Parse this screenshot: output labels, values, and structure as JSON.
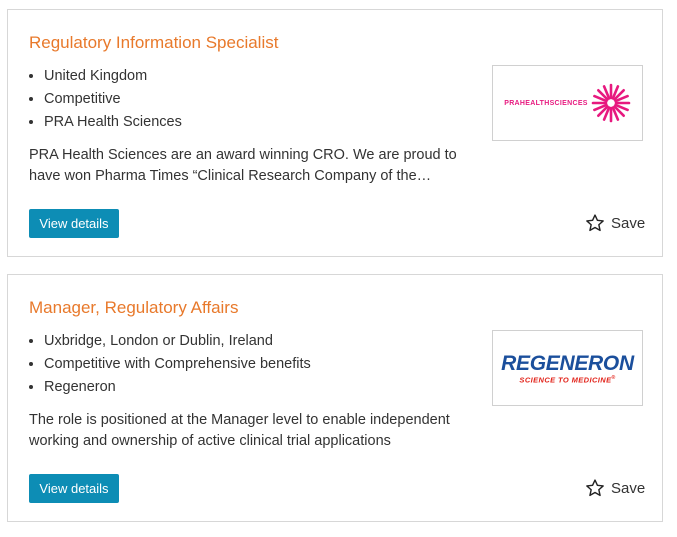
{
  "jobs": [
    {
      "title": "Regulatory Information Specialist",
      "meta": [
        "United Kingdom",
        "Competitive",
        "PRA Health Sciences"
      ],
      "description": "PRA Health Sciences are an award winning CRO. We are proud to have won Pharma Times “Clinical Research Company of the…",
      "logo": {
        "name": "PRAHEALTHSCIENCES",
        "color": "#e7197f"
      },
      "view_label": "View details",
      "save_label": "Save"
    },
    {
      "title": "Manager, Regulatory Affairs",
      "meta": [
        "Uxbridge, London or Dublin, Ireland",
        "Competitive with Comprehensive benefits",
        "Regeneron"
      ],
      "description": "The role is positioned at the Manager level to enable independent working and ownership of active clinical trial applications",
      "logo": {
        "name": "REGENERON",
        "tagline": "SCIENCE TO MEDICINE",
        "mark": "®",
        "color": "#1b4f9c",
        "tag_color": "#e2231a"
      },
      "view_label": "View details",
      "save_label": "Save"
    }
  ],
  "colors": {
    "title": "#e8792b",
    "button": "#0d8db5",
    "text": "#333333",
    "border": "#d7d7d7"
  },
  "icons": {
    "save": "star-outline-icon"
  }
}
